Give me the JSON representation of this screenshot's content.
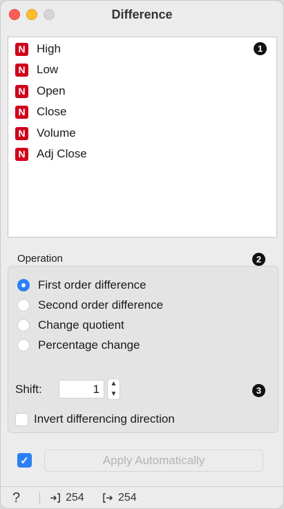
{
  "window": {
    "title": "Difference"
  },
  "variables": [
    {
      "type": "N",
      "name": "High"
    },
    {
      "type": "N",
      "name": "Low"
    },
    {
      "type": "N",
      "name": "Open"
    },
    {
      "type": "N",
      "name": "Close"
    },
    {
      "type": "N",
      "name": "Volume"
    },
    {
      "type": "N",
      "name": "Adj Close"
    }
  ],
  "markers": {
    "one": "1",
    "two": "2",
    "three": "3"
  },
  "operation": {
    "label": "Operation",
    "options": [
      {
        "label": "First order difference",
        "selected": true
      },
      {
        "label": "Second order difference",
        "selected": false
      },
      {
        "label": "Change quotient",
        "selected": false
      },
      {
        "label": "Percentage change",
        "selected": false
      }
    ],
    "shift_label": "Shift:",
    "shift_value": "1",
    "invert_label": "Invert differencing direction",
    "invert_checked": false
  },
  "apply": {
    "auto_checked": true,
    "button_label": "Apply Automatically"
  },
  "statusbar": {
    "help_icon": "?",
    "input_count": "254",
    "output_count": "254"
  },
  "colors": {
    "accent": "#2a7ff6",
    "numeric_badge": "#d0021b"
  }
}
